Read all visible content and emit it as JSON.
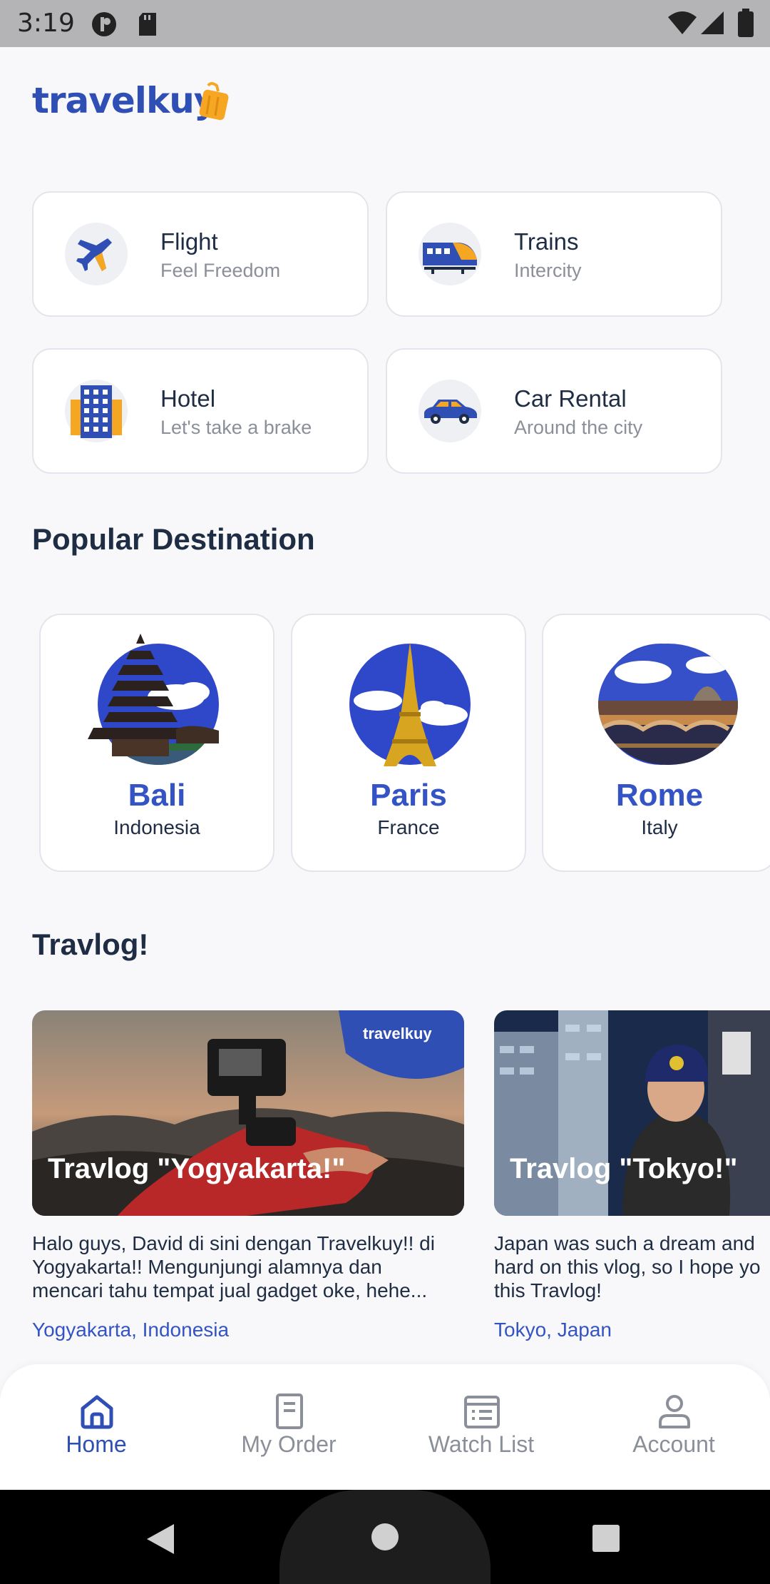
{
  "status_bar": {
    "time": "3:19"
  },
  "app": {
    "logo_text": "travelkuy"
  },
  "services": [
    {
      "title": "Flight",
      "subtitle": "Feel Freedom",
      "icon": "airplane-icon"
    },
    {
      "title": "Trains",
      "subtitle": "Intercity",
      "icon": "train-icon"
    },
    {
      "title": "Hotel",
      "subtitle": "Let's take a brake",
      "icon": "hotel-icon"
    },
    {
      "title": "Car Rental",
      "subtitle": "Around the city",
      "icon": "car-icon"
    }
  ],
  "popular": {
    "title": "Popular Destination",
    "items": [
      {
        "city": "Bali",
        "country": "Indonesia"
      },
      {
        "city": "Paris",
        "country": "France"
      },
      {
        "city": "Rome",
        "country": "Italy"
      }
    ]
  },
  "travlog": {
    "title": "Travlog!",
    "items": [
      {
        "caption": "Travlog \"Yogyakarta!\"",
        "badge": "travelkuy",
        "description": "Halo guys, David di sini dengan Travelkuy!! di\nYogyakarta!! Mengunjungi alamnya dan\nmencari tahu tempat jual gadget oke, hehe...",
        "location": "Yogyakarta, Indonesia"
      },
      {
        "caption": "Travlog \"Tokyo!\"",
        "description": "Japan was such a dream and\nhard on this vlog, so I hope yo\nthis Travlog!",
        "location": "Tokyo, Japan"
      }
    ]
  },
  "bottom_nav": [
    {
      "label": "Home",
      "icon": "home-icon",
      "active": true
    },
    {
      "label": "My Order",
      "icon": "receipt-icon",
      "active": false
    },
    {
      "label": "Watch List",
      "icon": "list-icon",
      "active": false
    },
    {
      "label": "Account",
      "icon": "user-icon",
      "active": false
    }
  ],
  "colors": {
    "brand": "#2f4fb4",
    "accent": "#f5a623",
    "text": "#1f2d44",
    "muted": "#8a8f99"
  }
}
